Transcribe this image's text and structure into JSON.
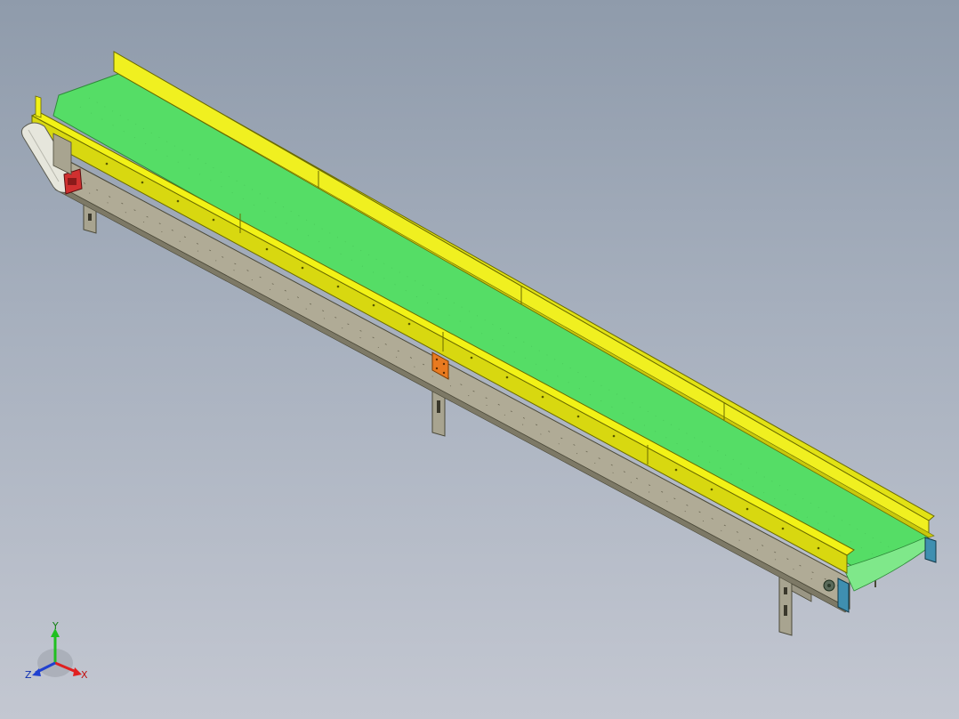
{
  "viewport": {
    "background_top": "#8f9bab",
    "background_bottom": "#c3c7d1"
  },
  "model": {
    "type": "belt-conveyor",
    "belt_color": "#55dd66",
    "guard_color": "#e8e800",
    "frame_color": "#a8a490",
    "bracket_color": "#e87a20",
    "motor_color": "#d03030",
    "end_cover_color": "#3f8fb0"
  },
  "triad": {
    "x_label": "X",
    "y_label": "Y",
    "z_label": "Z",
    "x_color": "#e02020",
    "y_color": "#20c020",
    "z_color": "#2040d0"
  }
}
